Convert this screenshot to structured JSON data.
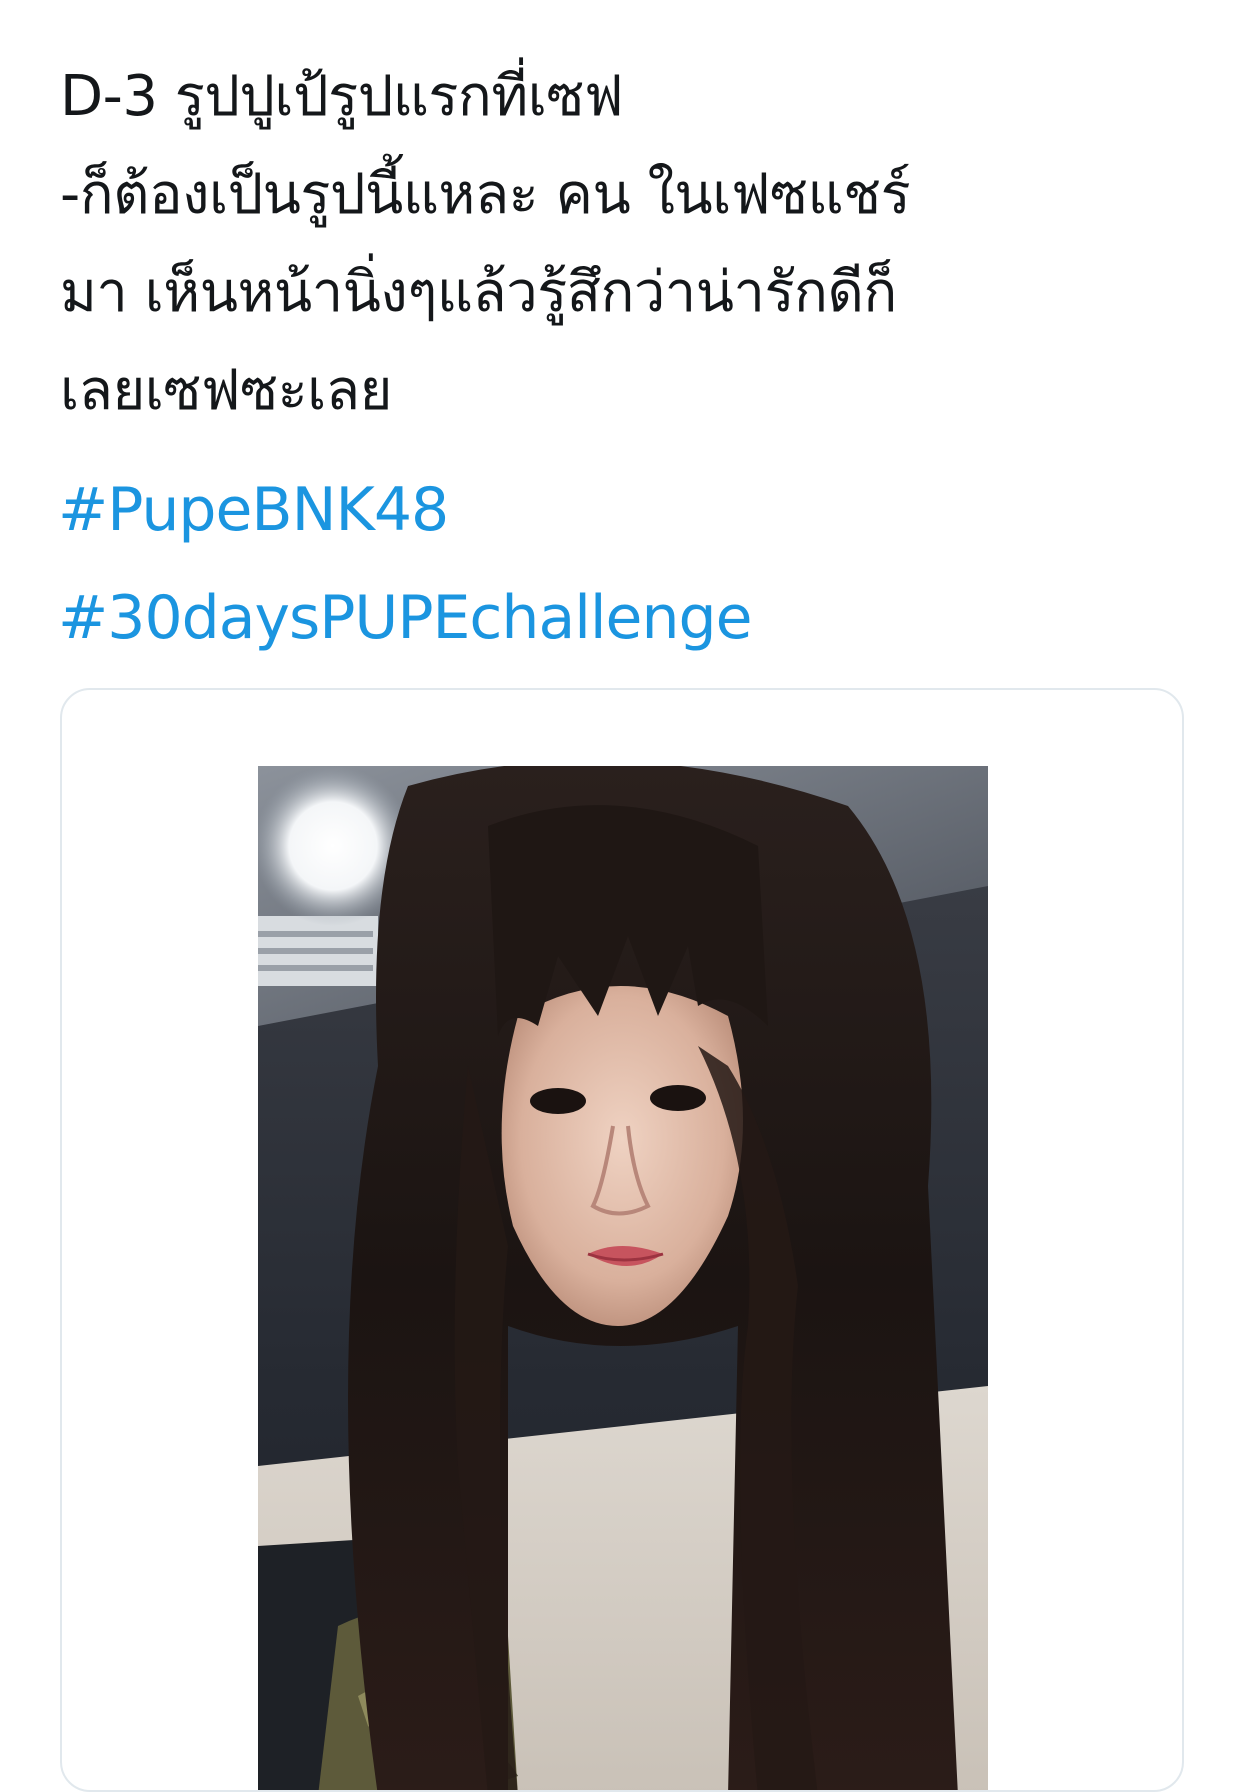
{
  "tweet": {
    "text_lines": [
      "D-3 รูปปูเป้รูปแรกที่เซฟ",
      "-ก็ต้องเป็นรูปนี้แหละ คน ในเฟซแชร์",
      "มา เห็นหน้านิ่งๆแล้วรู้สึกว่าน่ารักดีก็",
      "เลยเซฟซะเลย"
    ],
    "hashtags": [
      "#PupeBNK48",
      "#30daysPUPEchallenge"
    ]
  },
  "colors": {
    "text": "#14171a",
    "link": "#1b95e0",
    "card_border": "#e1e8ed"
  },
  "media": {
    "type": "photo",
    "icon": "photo-of-girl-selfie"
  }
}
